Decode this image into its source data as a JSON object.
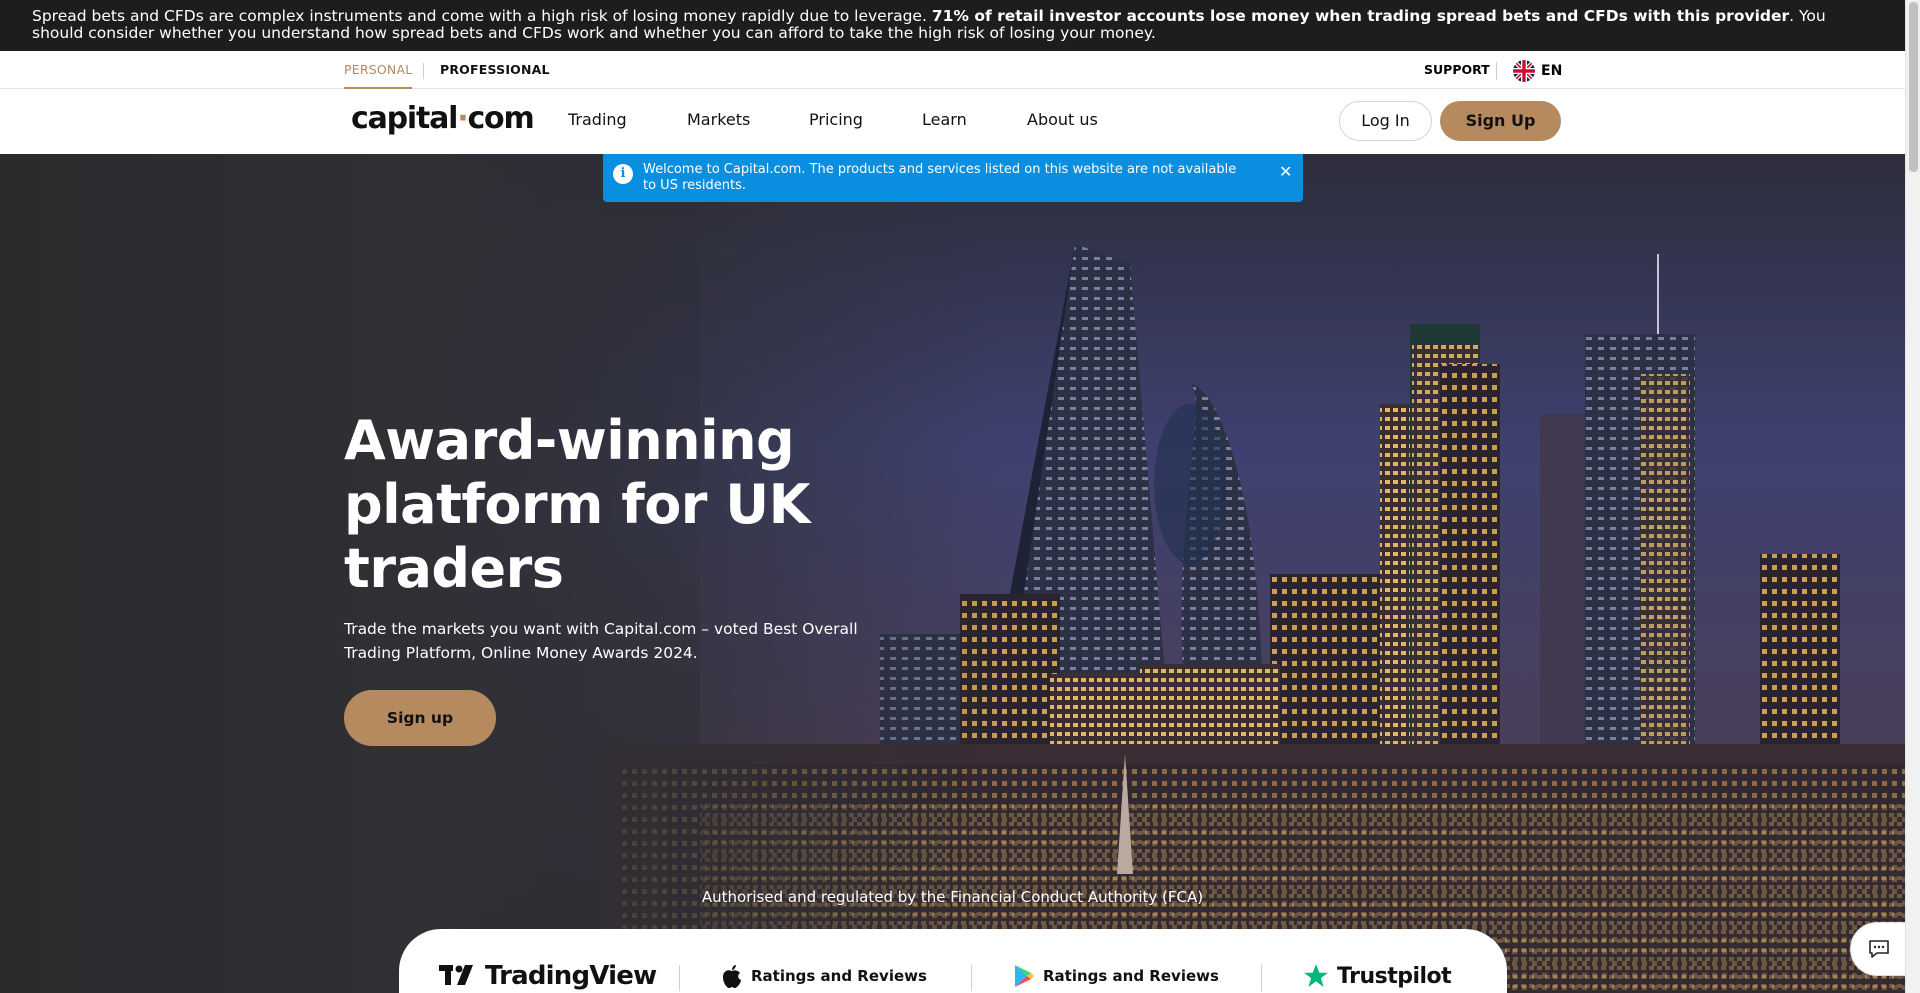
{
  "risk_warning": {
    "text_start": "Spread bets and CFDs are complex instruments and come with a high risk of losing money rapidly due to leverage. ",
    "text_bold": "71% of retail investor accounts lose money when trading spread bets and CFDs with this provider",
    "text_end": ". You should consider whether you understand how spread bets and CFDs work and whether you can afford to take the high risk of losing your money."
  },
  "segments": {
    "personal": "PERSONAL",
    "professional": "PROFESSIONAL"
  },
  "utility": {
    "support": "SUPPORT",
    "language": "EN"
  },
  "header": {
    "logo_left": "capital",
    "logo_dot": "·",
    "logo_right": "com",
    "nav": [
      "Trading",
      "Markets",
      "Pricing",
      "Learn",
      "About us"
    ],
    "login": "Log In",
    "signup": "Sign Up"
  },
  "notice": {
    "message": "Welcome to Capital.com. The products and services listed on this website are not available to US residents.",
    "close": "✕"
  },
  "hero": {
    "title": "Award-winning platform for UK traders",
    "subtitle": "Trade the markets you want with Capital.com – voted Best Overall Trading Platform, Online Money Awards 2024.",
    "cta": "Sign up",
    "regulation": "Authorised and regulated by the Financial Conduct Authority (FCA)"
  },
  "ratings": {
    "tradingview": "TradingView",
    "apple": "Ratings and Reviews",
    "google_play": "Ratings and Reviews",
    "trustpilot": "Trustpilot"
  },
  "colors": {
    "accent": "#b48a5e",
    "notice_blue": "#0a8ee0",
    "risk_bg": "#1d1d1d"
  },
  "icons": {
    "info": "info-icon",
    "close": "close-icon",
    "flag": "uk-flag-icon",
    "apple": "apple-icon",
    "play": "google-play-icon",
    "star": "trustpilot-star-icon",
    "chat": "chat-icon"
  }
}
